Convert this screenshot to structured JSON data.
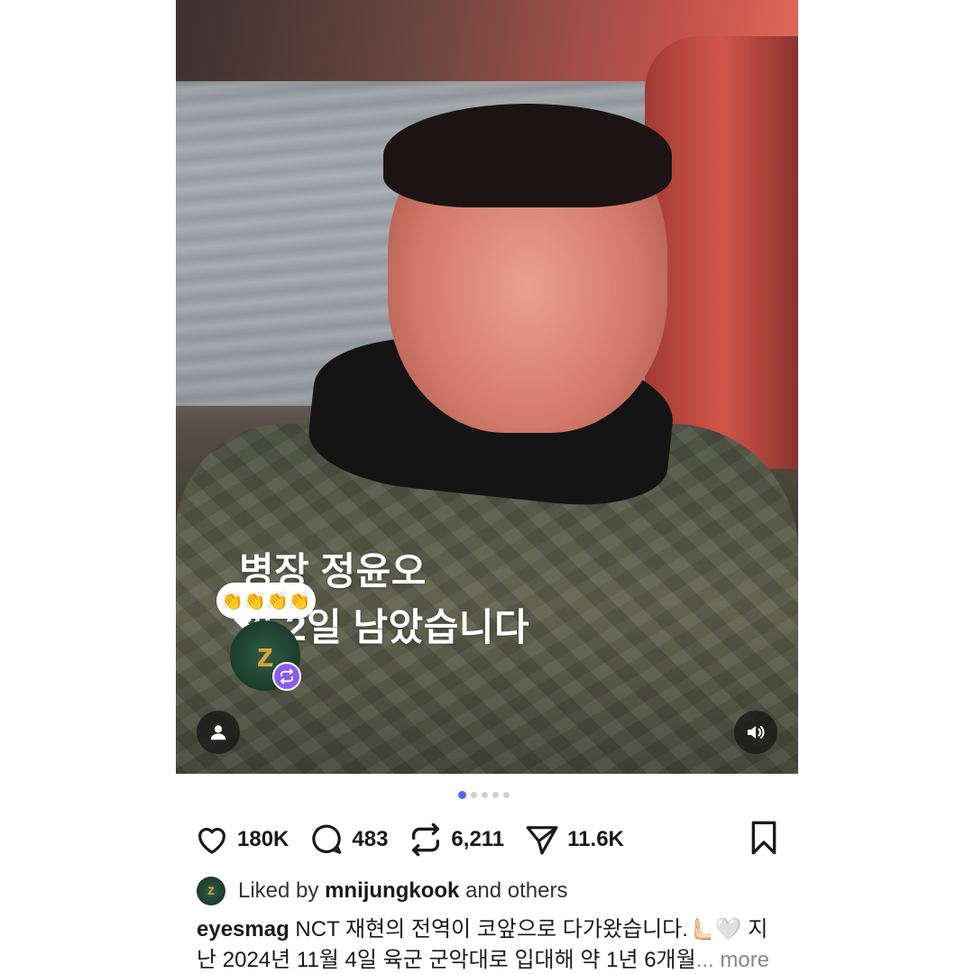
{
  "post": {
    "overlay_line1": "병장 정윤오",
    "overlay_line2": "역 2일 남았습니다",
    "emoji_reaction": "👏👏👏👏",
    "repost_avatar_glyph": "z",
    "carousel": {
      "total": 5,
      "active_index": 0
    }
  },
  "actions": {
    "likes": "180K",
    "comments": "483",
    "reposts": "6,211",
    "shares": "11.6K",
    "like_icon": "heart-icon",
    "comment_icon": "comment-icon",
    "repost_icon": "repost-icon",
    "share_icon": "send-icon",
    "bookmark_icon": "bookmark-icon"
  },
  "liked_by": {
    "prefix": "Liked by ",
    "user": "mnijungkook",
    "suffix": " and others"
  },
  "caption": {
    "username": "eyesmag",
    "text": " NCT 재현의 전역이 코앞으로 다가왔습니다.🫷🏻🤍 지난 2024년 11월 4일 육군 군악대로 입대해 약 1년 6개월",
    "more": "... more"
  },
  "colors": {
    "carousel_active": "#4a6cf7",
    "repost_badge": "#8a5cf0"
  }
}
